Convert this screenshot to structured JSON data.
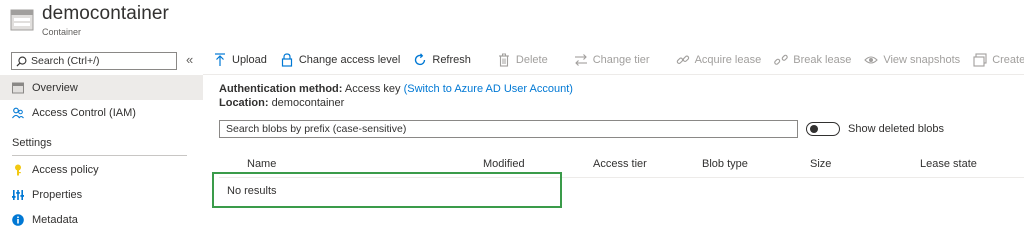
{
  "header": {
    "title": "democontainer",
    "subtitle": "Container",
    "icon": "container-icon"
  },
  "sidebar": {
    "search_placeholder": "Search (Ctrl+/)",
    "collapse_glyph": "«",
    "items": [
      {
        "label": "Overview",
        "icon": "overview-icon",
        "active": true
      },
      {
        "label": "Access Control (IAM)",
        "icon": "people-icon",
        "active": false
      }
    ],
    "settings_title": "Settings",
    "settings_items": [
      {
        "label": "Access policy",
        "icon": "key-icon"
      },
      {
        "label": "Properties",
        "icon": "properties-icon"
      },
      {
        "label": "Metadata",
        "icon": "info-icon"
      }
    ]
  },
  "toolbar": {
    "upload": "Upload",
    "change_access_level": "Change access level",
    "refresh": "Refresh",
    "delete": "Delete",
    "change_tier": "Change tier",
    "acquire_lease": "Acquire lease",
    "break_lease": "Break lease",
    "view_snapshots": "View snapshots",
    "create_snapshot": "Create snapshot"
  },
  "info": {
    "auth_label": "Authentication method:",
    "auth_value": "Access key",
    "auth_link": "(Switch to Azure AD User Account)",
    "location_label": "Location:",
    "location_value": "democontainer"
  },
  "blobs": {
    "search_placeholder": "Search blobs by prefix (case-sensitive)",
    "show_deleted_label": "Show deleted blobs",
    "show_deleted": false,
    "columns": [
      "Name",
      "Modified",
      "Access tier",
      "Blob type",
      "Size",
      "Lease state"
    ],
    "empty_text": "No results"
  },
  "colors": {
    "accent": "#0078d4",
    "highlight": "#3a9b4a",
    "active_nav": "#edebe9"
  }
}
